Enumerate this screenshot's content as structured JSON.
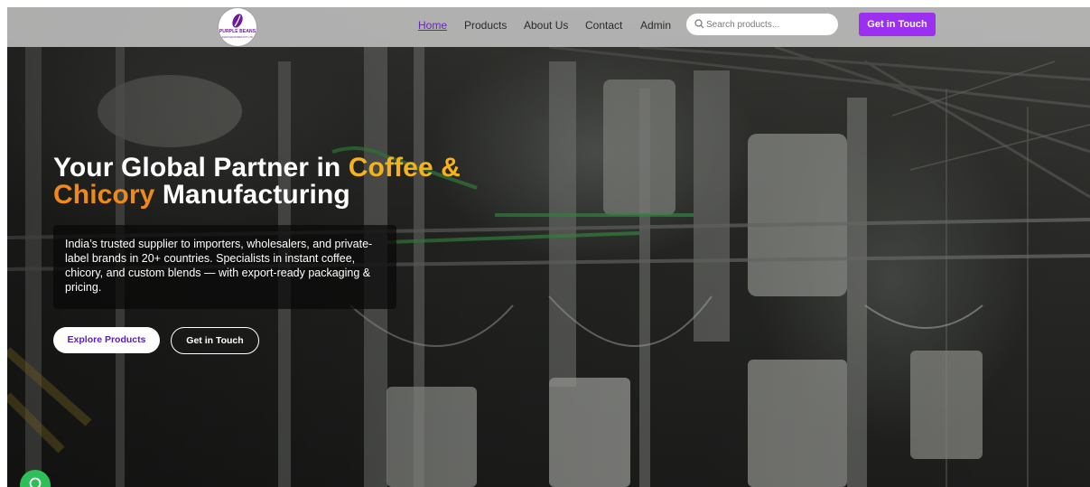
{
  "brand": {
    "name": "PURPLE BEANS",
    "tagline": "AGRO INDUSTRIES PVT. LTD."
  },
  "nav": {
    "items": [
      {
        "label": "Home",
        "active": true
      },
      {
        "label": "Products",
        "active": false
      },
      {
        "label": "About Us",
        "active": false
      },
      {
        "label": "Contact",
        "active": false
      },
      {
        "label": "Admin",
        "active": false
      }
    ],
    "search_placeholder": "Search products...",
    "cta_label": "Get in Touch"
  },
  "hero": {
    "headline_part1": "Your Global Partner in ",
    "headline_accent1": "Coffee &",
    "headline_accent2": "Chicory",
    "headline_part2": " Manufacturing",
    "description": "India’s trusted supplier to importers, wholesalers, and private-label brands in 20+ countries. Specialists in instant coffee, chicory, and custom blends — with export-ready packaging & pricing.",
    "primary_button": "Explore Products",
    "secondary_button": "Get in Touch"
  },
  "icons": {
    "search": "search-icon",
    "chat": "chat-icon",
    "logo": "coffee-bean-icon"
  },
  "colors": {
    "accent_purple": "#9b30f0",
    "active_link": "#6b21c8",
    "headline_yellow": "#f5b21b",
    "headline_orange": "#ee8a1c",
    "chat_green": "#2fbf59"
  }
}
